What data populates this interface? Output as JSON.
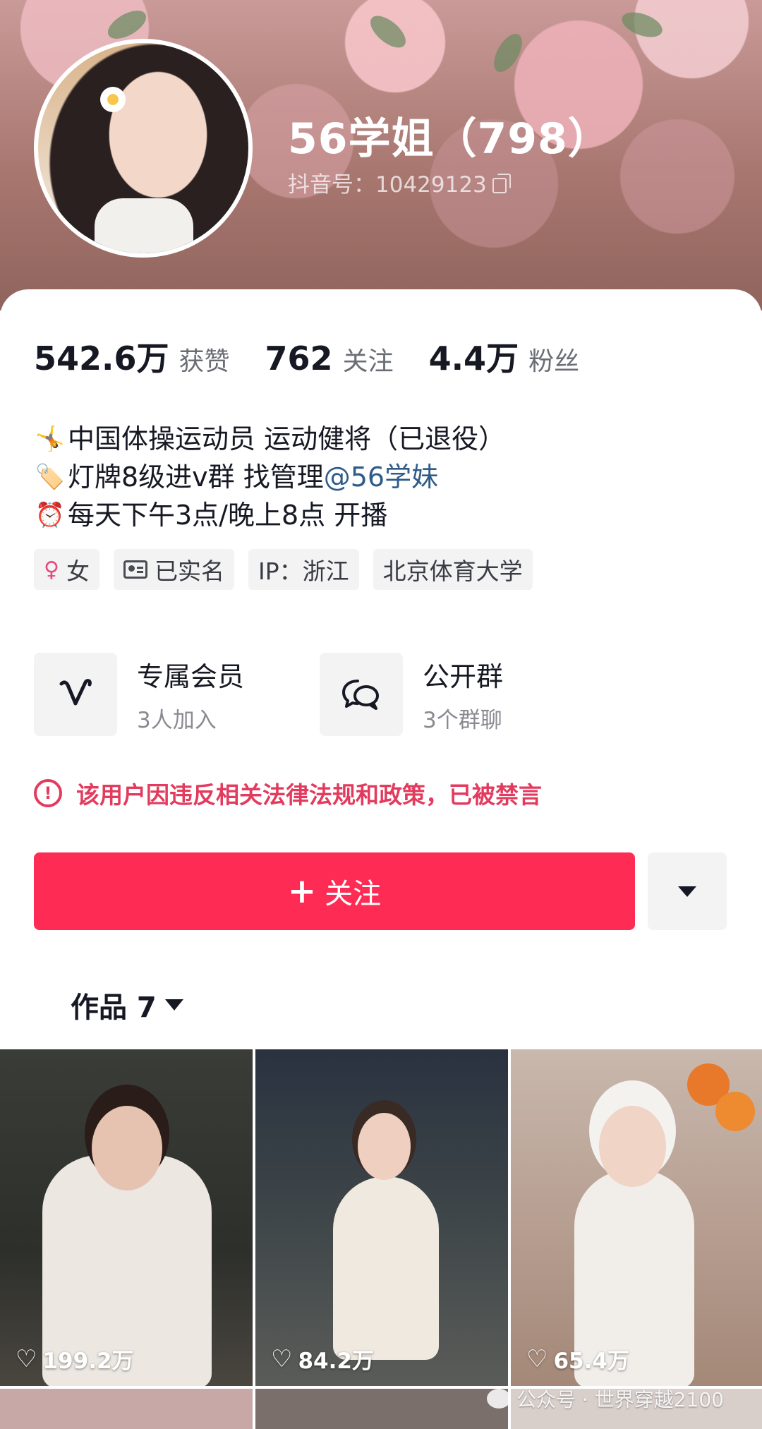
{
  "profile": {
    "name": "56学姐（798）",
    "douyin_id": "抖音号：10429123"
  },
  "stats": [
    {
      "value": "542.6万",
      "label": "获赞"
    },
    {
      "value": "762",
      "label": "关注"
    },
    {
      "value": "4.4万",
      "label": "粉丝"
    }
  ],
  "bio": {
    "line1": {
      "emoji": "🤸",
      "text": "中国体操运动员 运动健将（已退役）"
    },
    "line2": {
      "emoji": "🏷️",
      "text": "灯牌8级进v群 找管理",
      "mention": "@56学妹"
    },
    "line3": {
      "emoji": "⏰",
      "text": "每天下午3点/晚上8点 开播"
    }
  },
  "tags": {
    "gender": "女",
    "verified": "已实名",
    "ip": "IP：浙江",
    "school": "北京体育大学"
  },
  "services": [
    {
      "title": "专属会员",
      "subtitle": "3人加入",
      "icon": "vip-v-icon"
    },
    {
      "title": "公开群",
      "subtitle": "3个群聊",
      "icon": "chat-bubbles-icon"
    }
  ],
  "warning": {
    "text": "该用户因违反相关法律法规和政策，已被禁言",
    "color": "#e23b5e"
  },
  "follow": {
    "plus": "+",
    "label": "关注",
    "color": "#fe2c55"
  },
  "works_tab": {
    "label": "作品 7"
  },
  "videos": [
    {
      "likes": "199.2万"
    },
    {
      "likes": "84.2万"
    },
    {
      "likes": "65.4万"
    }
  ],
  "watermark": "公众号 · 世界穿越2100"
}
